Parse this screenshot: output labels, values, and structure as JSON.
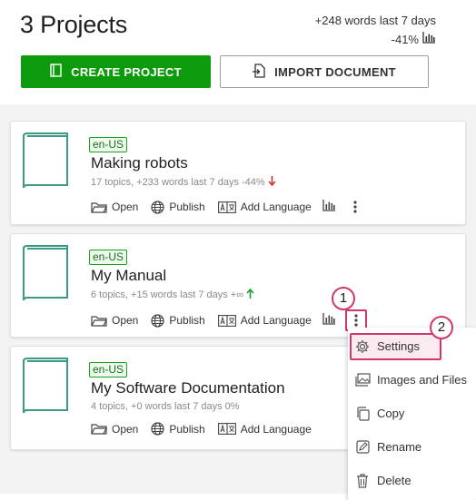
{
  "header": {
    "title": "3 Projects",
    "words_stat": "+248 words last 7 days",
    "percent_stat": "-41%",
    "create_label": "CREATE PROJECT",
    "import_label": "IMPORT DOCUMENT"
  },
  "projects": [
    {
      "lang": "en-US",
      "name": "Making robots",
      "meta": "17 topics, +233 words last 7 days -44%",
      "trend": "down"
    },
    {
      "lang": "en-US",
      "name": "My Manual",
      "meta": "6 topics, +15 words last 7 days +∞",
      "trend": "up"
    },
    {
      "lang": "en-US",
      "name": "My Software Documentation",
      "meta": "4 topics, +0 words last 7 days 0%",
      "trend": "none"
    }
  ],
  "actions": {
    "open": "Open",
    "publish": "Publish",
    "add_language": "Add Language"
  },
  "menu": {
    "settings": "Settings",
    "images": "Images and Files",
    "copy": "Copy",
    "rename": "Rename",
    "delete": "Delete"
  },
  "callouts": {
    "one": "1",
    "two": "2"
  },
  "colors": {
    "accent": "#0d9a0d",
    "highlight": "#d1366f",
    "book": "#3a9a85",
    "down": "#d32f2f",
    "up": "#1b9e3a"
  }
}
